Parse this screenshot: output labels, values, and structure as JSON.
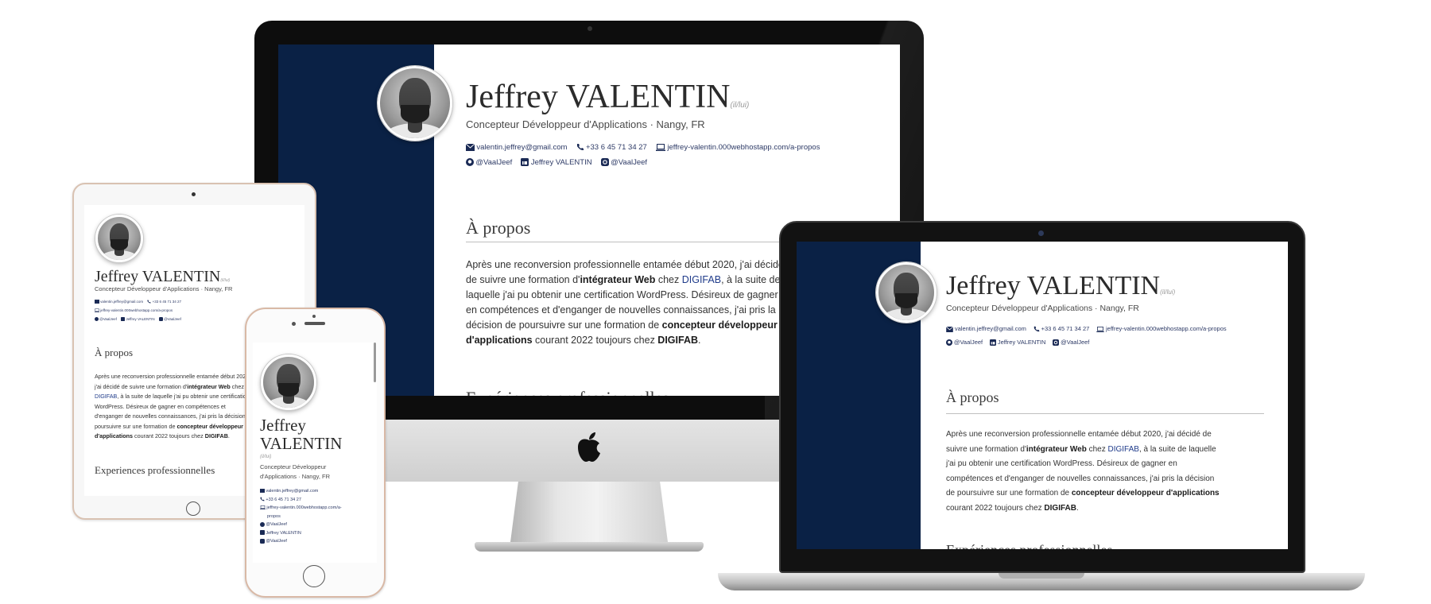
{
  "profile": {
    "name": "Jeffrey VALENTIN",
    "name_first": "Jeffrey",
    "name_last": "VALENTIN",
    "pronouns": "(il/lui)",
    "subtitle": "Concepteur Développeur d'Applications · Nangy, FR",
    "subtitle_line1": "Concepteur Développeur",
    "subtitle_line2": "d'Applications · Nangy, FR",
    "email": "valentin.jeffrey@gmail.com",
    "phone": "+33 6 45 71 34 27",
    "website": "jeffrey-valentin.000webhostapp.com/a-propos",
    "website_line1": "jeffrey-valentin.000webhostapp.com/a-",
    "website_line2": "propos",
    "github": "@VaalJeef",
    "linkedin": "Jeffrey VALENTIN",
    "instagram": "@VaalJeef"
  },
  "about": {
    "title": "À propos",
    "p1": "Après une reconversion professionnelle entamée début 2020, j'ai décidé de suivre une formation d'",
    "bold1": "intégrateur Web",
    "p2": " chez ",
    "link": "DIGIFAB",
    "p3": ", à la suite de laquelle j'ai pu obtenir une certification WordPress. Désireux de gagner en compétences et d'enganger de nouvelles connaissances, j'ai pris la décision de poursuivre sur une formation de ",
    "bold2": "concepteur développeur d'applications",
    "p4": " courant 2022 toujours chez ",
    "bold3": "DIGIFAB",
    "p5": "."
  },
  "experiences": {
    "title": "Experiences professionnelles",
    "title_cut": "Expériences professionnelles"
  },
  "colors": {
    "band": "#0a2145",
    "link": "#1f3b8a"
  },
  "icons": [
    "envelope-icon",
    "phone-icon",
    "laptop-icon",
    "github-icon",
    "linkedin-icon",
    "instagram-icon",
    "apple-logo-icon"
  ]
}
